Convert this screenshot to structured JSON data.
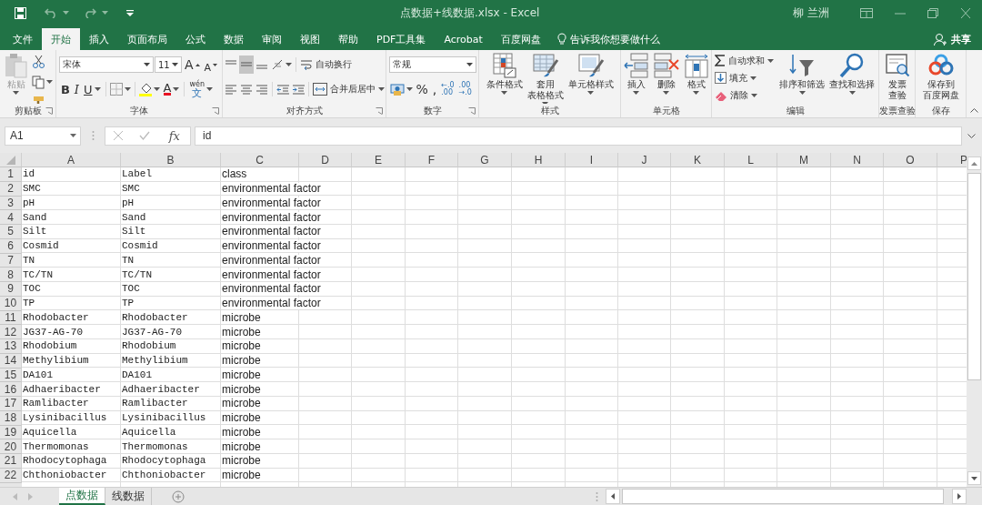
{
  "title_bar": {
    "title": "点数据+线数据.xlsx  -  Excel",
    "user": "柳 兰洲"
  },
  "ribbon_tabs": [
    {
      "label": "文件",
      "selected": false
    },
    {
      "label": "开始",
      "selected": true
    },
    {
      "label": "插入",
      "selected": false
    },
    {
      "label": "页面布局",
      "selected": false
    },
    {
      "label": "公式",
      "selected": false
    },
    {
      "label": "数据",
      "selected": false
    },
    {
      "label": "审阅",
      "selected": false
    },
    {
      "label": "视图",
      "selected": false
    },
    {
      "label": "帮助",
      "selected": false
    },
    {
      "label": "PDF工具集",
      "selected": false
    },
    {
      "label": "Acrobat",
      "selected": false
    },
    {
      "label": "百度网盘",
      "selected": false
    }
  ],
  "tell_me": "告诉我你想要做什么",
  "share": "共享",
  "ribbon_groups": [
    {
      "label": "剪贴板",
      "launcher": true,
      "controls": [
        {
          "kind": "large",
          "label": "粘贴",
          "disabled": true,
          "dropdown": true
        }
      ]
    },
    {
      "label": "字体",
      "launcher": true,
      "controls": [
        {
          "kind": "combo",
          "value": "宋体"
        },
        {
          "kind": "combo",
          "value": "11"
        },
        {
          "kind": "grow",
          "label": "A"
        },
        {
          "kind": "shrink",
          "label": "A"
        },
        {
          "kind": "bold",
          "label": "B"
        },
        {
          "kind": "italic",
          "label": "I"
        },
        {
          "kind": "underline",
          "label": "U",
          "dropdown": true
        },
        {
          "kind": "font_color",
          "label": "A",
          "dropdown": true
        },
        {
          "kind": "phonetic",
          "label": "文",
          "ruby": "wén",
          "dropdown": true
        }
      ]
    },
    {
      "label": "对齐方式",
      "launcher": true,
      "vertical_align": [
        {
          "selected": false
        },
        {
          "selected": true
        },
        {
          "selected": false
        }
      ],
      "controls": [
        {
          "kind": "small",
          "label": "自动换行"
        },
        {
          "kind": "small",
          "label": "合并后居中",
          "dropdown": true
        }
      ]
    },
    {
      "label": "数字",
      "launcher": true,
      "controls": [
        {
          "kind": "combo",
          "value": "常规"
        },
        {
          "kind": "glyph",
          "label": "%"
        },
        {
          "kind": "glyph",
          "label": ","
        },
        {
          "kind": "decimal",
          "label": "←.0\n.00"
        },
        {
          "kind": "decimal",
          "label": ".00\n→.0"
        }
      ]
    },
    {
      "label": "样式",
      "controls": [
        {
          "kind": "large",
          "label": "条件格式",
          "dropdown": true
        },
        {
          "kind": "large",
          "lines": [
            "套用",
            "表格格式"
          ],
          "dropdown": true
        },
        {
          "kind": "large",
          "label": "单元格样式",
          "dropdown": true
        }
      ]
    },
    {
      "label": "单元格",
      "controls": [
        {
          "kind": "large",
          "label": "插入",
          "dropdown": true
        },
        {
          "kind": "large",
          "label": "删除",
          "dropdown": true
        },
        {
          "kind": "large",
          "label": "格式",
          "dropdown": true
        }
      ]
    },
    {
      "label": "编辑",
      "controls": [
        {
          "kind": "small",
          "label": "自动求和",
          "dropdown": true
        },
        {
          "kind": "small",
          "label": "填充",
          "dropdown": true
        },
        {
          "kind": "small",
          "label": "清除",
          "dropdown": true
        },
        {
          "kind": "large",
          "label": "排序和筛选",
          "dropdown": true
        },
        {
          "kind": "large",
          "label": "查找和选择",
          "dropdown": true
        }
      ]
    },
    {
      "label": "发票查验",
      "controls": [
        {
          "kind": "large",
          "lines": [
            "发票",
            "查验"
          ]
        }
      ]
    },
    {
      "label": "保存",
      "controls": [
        {
          "kind": "large",
          "lines": [
            "保存到",
            "百度网盘"
          ]
        }
      ]
    }
  ],
  "formula_bar": {
    "name_box": "A1",
    "function_label": "fx",
    "formula": "id"
  },
  "columns": [
    "A",
    "B",
    "C",
    "D",
    "E",
    "F",
    "G",
    "H",
    "I",
    "J",
    "K",
    "L",
    "M",
    "N",
    "O",
    "P"
  ],
  "rows": [
    {
      "header": "1",
      "cells": [
        "id",
        "Label",
        "class"
      ]
    },
    {
      "header": "2",
      "cells": [
        "SMC",
        "SMC",
        "environmental factor"
      ]
    },
    {
      "header": "3",
      "cells": [
        "pH",
        "pH",
        "environmental factor"
      ]
    },
    {
      "header": "4",
      "cells": [
        "Sand",
        "Sand",
        "environmental factor"
      ]
    },
    {
      "header": "5",
      "cells": [
        "Silt",
        "Silt",
        "environmental factor"
      ]
    },
    {
      "header": "6",
      "cells": [
        "Cosmid",
        "Cosmid",
        "environmental factor"
      ]
    },
    {
      "header": "7",
      "cells": [
        "TN",
        "TN",
        "environmental factor"
      ]
    },
    {
      "header": "8",
      "cells": [
        "TC/TN",
        "TC/TN",
        "environmental factor"
      ]
    },
    {
      "header": "9",
      "cells": [
        "TOC",
        "TOC",
        "environmental factor"
      ]
    },
    {
      "header": "10",
      "cells": [
        "TP",
        "TP",
        "environmental factor"
      ]
    },
    {
      "header": "11",
      "cells": [
        "Rhodobacter",
        "Rhodobacter",
        "microbe"
      ]
    },
    {
      "header": "12",
      "cells": [
        "JG37-AG-70",
        "JG37-AG-70",
        "microbe"
      ]
    },
    {
      "header": "13",
      "cells": [
        "Rhodobium",
        "Rhodobium",
        "microbe"
      ]
    },
    {
      "header": "14",
      "cells": [
        "Methylibium",
        "Methylibium",
        "microbe"
      ]
    },
    {
      "header": "15",
      "cells": [
        "DA101",
        "DA101",
        "microbe"
      ]
    },
    {
      "header": "16",
      "cells": [
        "Adhaeribacter",
        "Adhaeribacter",
        "microbe"
      ]
    },
    {
      "header": "17",
      "cells": [
        "Ramlibacter",
        "Ramlibacter",
        "microbe"
      ]
    },
    {
      "header": "18",
      "cells": [
        "Lysinibacillus",
        "Lysinibacillus",
        "microbe"
      ]
    },
    {
      "header": "19",
      "cells": [
        "Aquicella",
        "Aquicella",
        "microbe"
      ]
    },
    {
      "header": "20",
      "cells": [
        "Thermomonas",
        "Thermomonas",
        "microbe"
      ]
    },
    {
      "header": "21",
      "cells": [
        "Rhodocytophaga",
        "Rhodocytophaga",
        "microbe"
      ]
    },
    {
      "header": "22",
      "cells": [
        "Chthoniobacter",
        "Chthoniobacter",
        "microbe"
      ]
    }
  ],
  "sheet_tabs": [
    {
      "label": "点数据",
      "selected": true
    },
    {
      "label": "线数据",
      "selected": false
    }
  ]
}
